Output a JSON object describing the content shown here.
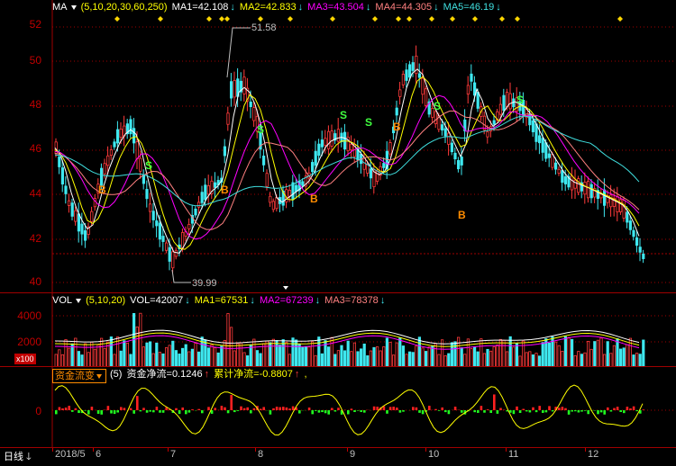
{
  "price_legend": {
    "name": "MA",
    "params": "(5,10,20,30,60,250)",
    "ma1": "MA1=42.108",
    "ma2": "MA2=42.833",
    "ma3": "MA3=43.504",
    "ma4": "MA4=44.305",
    "ma5": "MA5=46.19"
  },
  "price_axis": {
    "labels": [
      "52",
      "50",
      "48",
      "46",
      "44",
      "42",
      "40"
    ]
  },
  "price_annotations": {
    "high": "51.58",
    "low": "39.99"
  },
  "signals": {
    "buy": "B",
    "sell": "S"
  },
  "volume_legend": {
    "name": "VOL",
    "params": "(5,10,20)",
    "vol": "VOL=42007",
    "ma1": "MA1=67531",
    "ma2": "MA2=67239",
    "ma3": "MA3=78378"
  },
  "volume_axis": {
    "labels": [
      "4000",
      "2000"
    ],
    "unit": "x100"
  },
  "flow_legend": {
    "name": "资金流变",
    "params": "(5)",
    "net": "资金净流=0.1246",
    "cum": "累计净流=-0.8807",
    "tail": ","
  },
  "flow_axis": {
    "labels": [
      "0"
    ]
  },
  "x_axis": {
    "period": "日线",
    "labels": [
      "2018/5",
      "6",
      "7",
      "8",
      "9",
      "10",
      "11",
      "12"
    ]
  },
  "colors": {
    "up": "#ff3b3b",
    "down": "#3ee8f0",
    "grid": "#a00000",
    "ma1": "#ffffff",
    "ma2": "#ffff00",
    "ma3": "#ff00ff",
    "ma4": "#ff8080",
    "ma5": "#40e0e0"
  }
}
